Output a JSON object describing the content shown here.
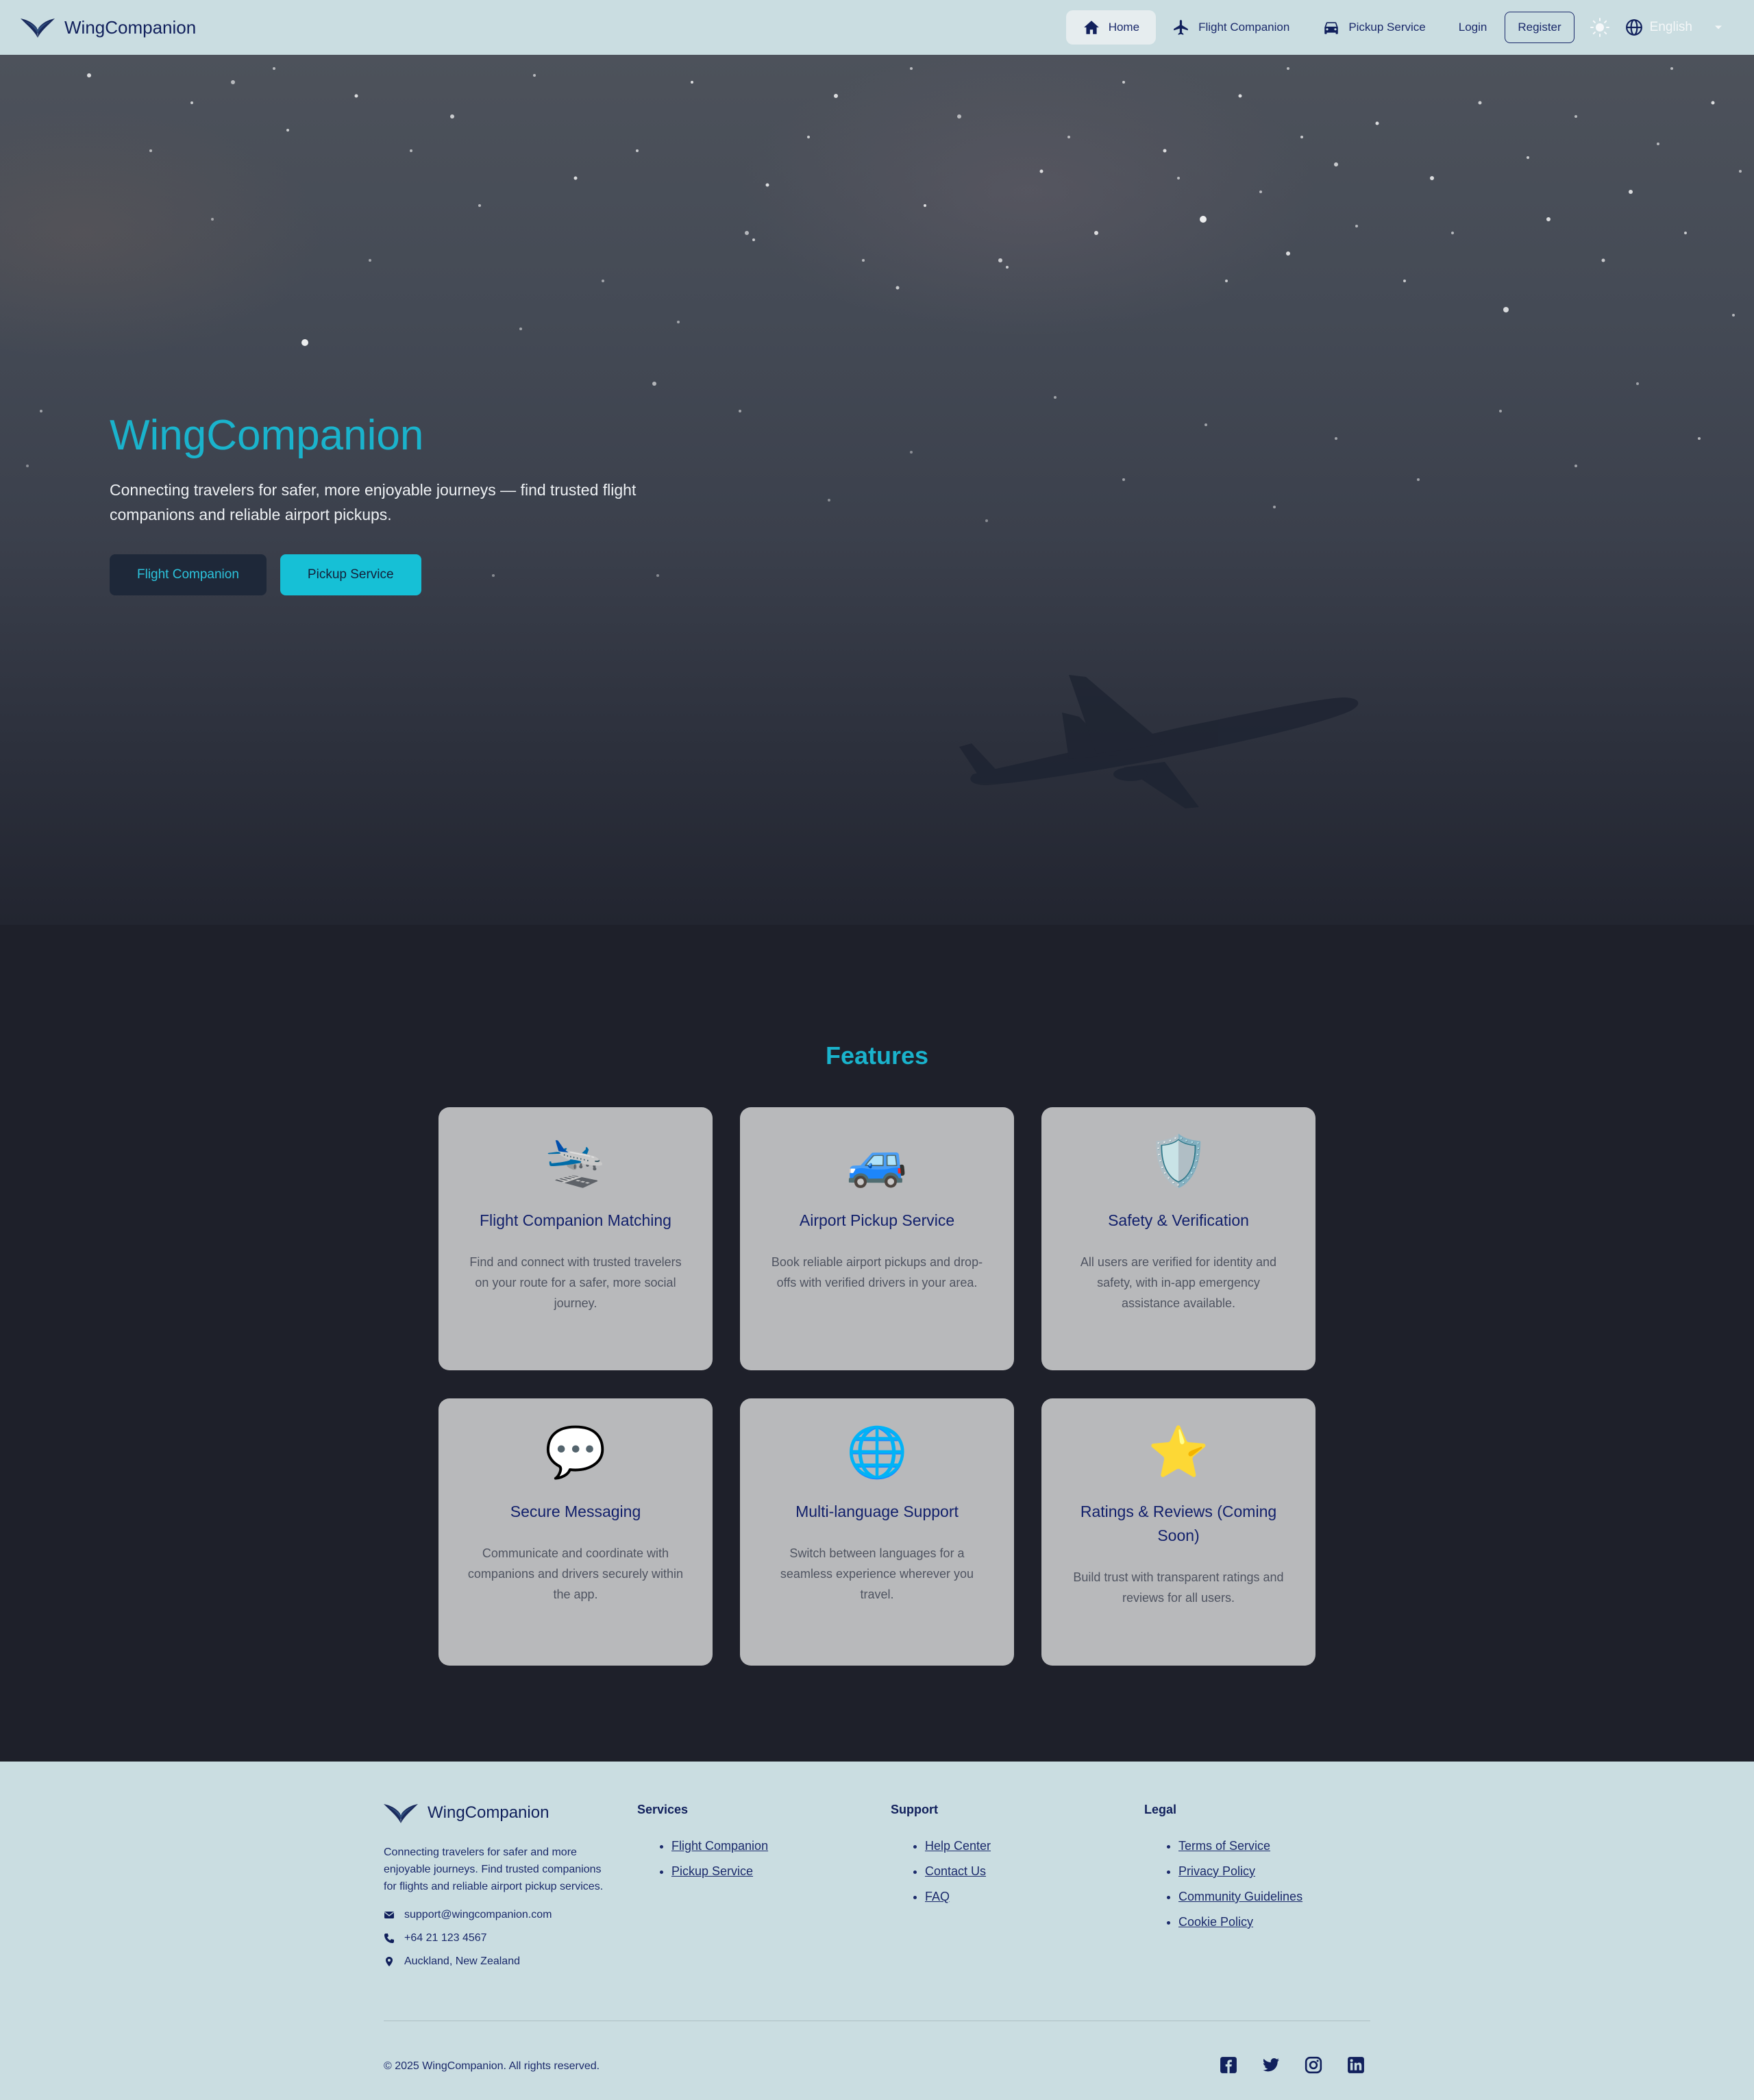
{
  "nav": {
    "brand": "WingCompanion",
    "home": "Home",
    "flight_companion": "Flight Companion",
    "pickup_service": "Pickup Service",
    "login": "Login",
    "register": "Register",
    "language": "English"
  },
  "hero": {
    "title": "WingCompanion",
    "subtitle": "Connecting travelers for safer, more enjoyable journeys — find trusted flight companions and reliable airport pickups.",
    "btn_flight": "Flight Companion",
    "btn_pickup": "Pickup Service"
  },
  "features": {
    "title": "Features",
    "cards": [
      {
        "icon": "🛬",
        "icon_name": "airplane-landing-icon",
        "title": "Flight Companion Matching",
        "desc": "Find and connect with trusted travelers on your route for a safer, more social journey."
      },
      {
        "icon": "🚙",
        "icon_name": "car-icon",
        "title": "Airport Pickup Service",
        "desc": "Book reliable airport pickups and drop-offs with verified drivers in your area."
      },
      {
        "icon": "🛡️",
        "icon_name": "shield-icon",
        "title": "Safety & Verification",
        "desc": "All users are verified for identity and safety, with in-app emergency assistance available."
      },
      {
        "icon": "💬",
        "icon_name": "speech-bubble-icon",
        "title": "Secure Messaging",
        "desc": "Communicate and coordinate with companions and drivers securely within the app."
      },
      {
        "icon": "🌐",
        "icon_name": "globe-icon",
        "title": "Multi-language Support",
        "desc": "Switch between languages for a seamless experience wherever you travel."
      },
      {
        "icon": "⭐",
        "icon_name": "star-icon",
        "title": "Ratings & Reviews (Coming Soon)",
        "desc": "Build trust with transparent ratings and reviews for all users."
      }
    ]
  },
  "footer": {
    "brand": "WingCompanion",
    "desc": "Connecting travelers for safer and more enjoyable journeys. Find trusted companions for flights and reliable airport pickup services.",
    "email": "support@wingcompanion.com",
    "phone": "+64 21 123 4567",
    "location": "Auckland, New Zealand",
    "services": {
      "heading": "Services",
      "links": [
        "Flight Companion",
        "Pickup Service"
      ]
    },
    "support": {
      "heading": "Support",
      "links": [
        "Help Center",
        "Contact Us",
        "FAQ"
      ]
    },
    "legal": {
      "heading": "Legal",
      "links": [
        "Terms of Service",
        "Privacy Policy",
        "Community Guidelines",
        "Cookie Policy"
      ]
    },
    "copyright": "© 2025 WingCompanion. All rights reserved."
  },
  "colors": {
    "accent": "#1ab3cc",
    "nav_bg": "#cadde1",
    "dark_bg": "#1e202a",
    "card_bg": "#b8b9bb",
    "text_navy": "#1b2a6b"
  }
}
